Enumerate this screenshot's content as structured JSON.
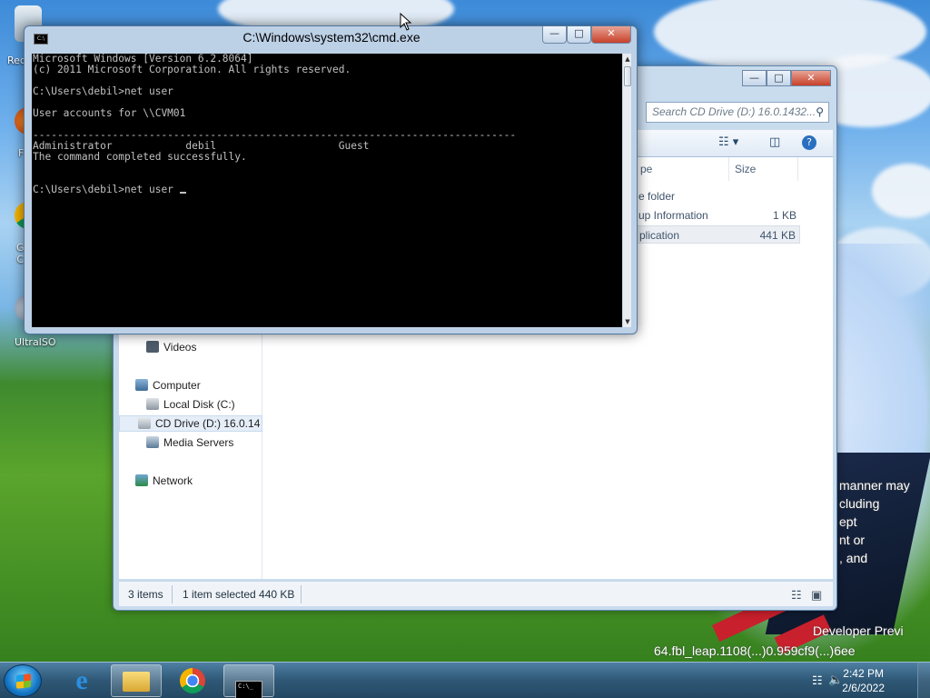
{
  "desktop": {
    "icons": [
      {
        "label": "Rec"
      },
      {
        "label": "F"
      },
      {
        "label": "G\nC"
      },
      {
        "label": "UltraISO"
      }
    ],
    "watermark": {
      "lines": [
        "manner may",
        "cluding",
        "ept",
        "nt or",
        ", and"
      ],
      "build_line1": "Developer Previ",
      "build_line2": "64.fbl_leap.1108(...)0.959cf9(...)6ee"
    }
  },
  "cmd": {
    "title": "C:\\Windows\\system32\\cmd.exe",
    "icon": "cmd-icon",
    "caption": {
      "minimize": "—",
      "maximize": "□",
      "close": "✕"
    },
    "console_lines": [
      "Microsoft Windows [Version 6.2.8064]",
      "(c) 2011 Microsoft Corporation. All rights reserved.",
      "",
      "C:\\Users\\debil>net user",
      "",
      "User accounts for \\\\CVM01",
      "",
      "-------------------------------------------------------------------------------",
      "Administrator            debil                    Guest",
      "The command completed successfully.",
      "",
      "",
      "C:\\Users\\debil>net user "
    ]
  },
  "explorer": {
    "caption": {
      "minimize": "—",
      "maximize": "□",
      "close": "✕"
    },
    "search_placeholder": "Search CD Drive (D:) 16.0.1432...",
    "columns": {
      "type": "pe",
      "size": "Size"
    },
    "files": [
      {
        "name": "e folder",
        "size": ""
      },
      {
        "name": "up Information",
        "size": "1 KB"
      },
      {
        "name": "plication",
        "size": "441 KB"
      }
    ],
    "nav": {
      "videos": "Videos",
      "computer": "Computer",
      "local_disk": "Local Disk (C:)",
      "cd_drive": "CD Drive (D:) 16.0.14",
      "media_servers": "Media Servers",
      "network": "Network"
    },
    "status": {
      "items": "3 items",
      "selected": "1 item selected  440 KB"
    }
  },
  "taskbar": {
    "time": "2:42 PM",
    "date": "2/6/2022",
    "buttons": [
      "internet-explorer-icon",
      "file-explorer-icon",
      "chrome-icon",
      "cmd-icon"
    ]
  }
}
